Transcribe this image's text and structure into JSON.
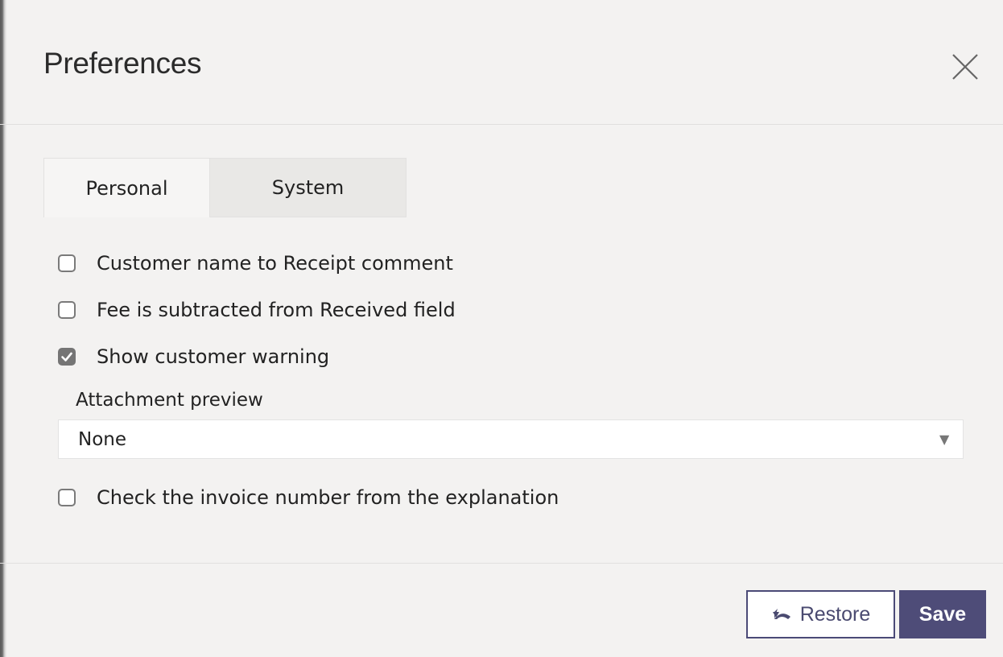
{
  "dialog": {
    "title": "Preferences"
  },
  "tabs": [
    {
      "label": "Personal",
      "active": true
    },
    {
      "label": "System",
      "active": false
    }
  ],
  "options": [
    {
      "label": "Customer name to Receipt comment",
      "checked": false
    },
    {
      "label": "Fee is subtracted from Received field",
      "checked": false
    },
    {
      "label": "Show customer warning",
      "checked": true
    },
    {
      "label": "Check the invoice number from the explanation",
      "checked": false
    }
  ],
  "attachment_preview": {
    "label": "Attachment preview",
    "selected": "None"
  },
  "buttons": {
    "restore": "Restore",
    "save": "Save"
  },
  "colors": {
    "accent": "#4e4c78",
    "background": "#f3f2f1"
  }
}
